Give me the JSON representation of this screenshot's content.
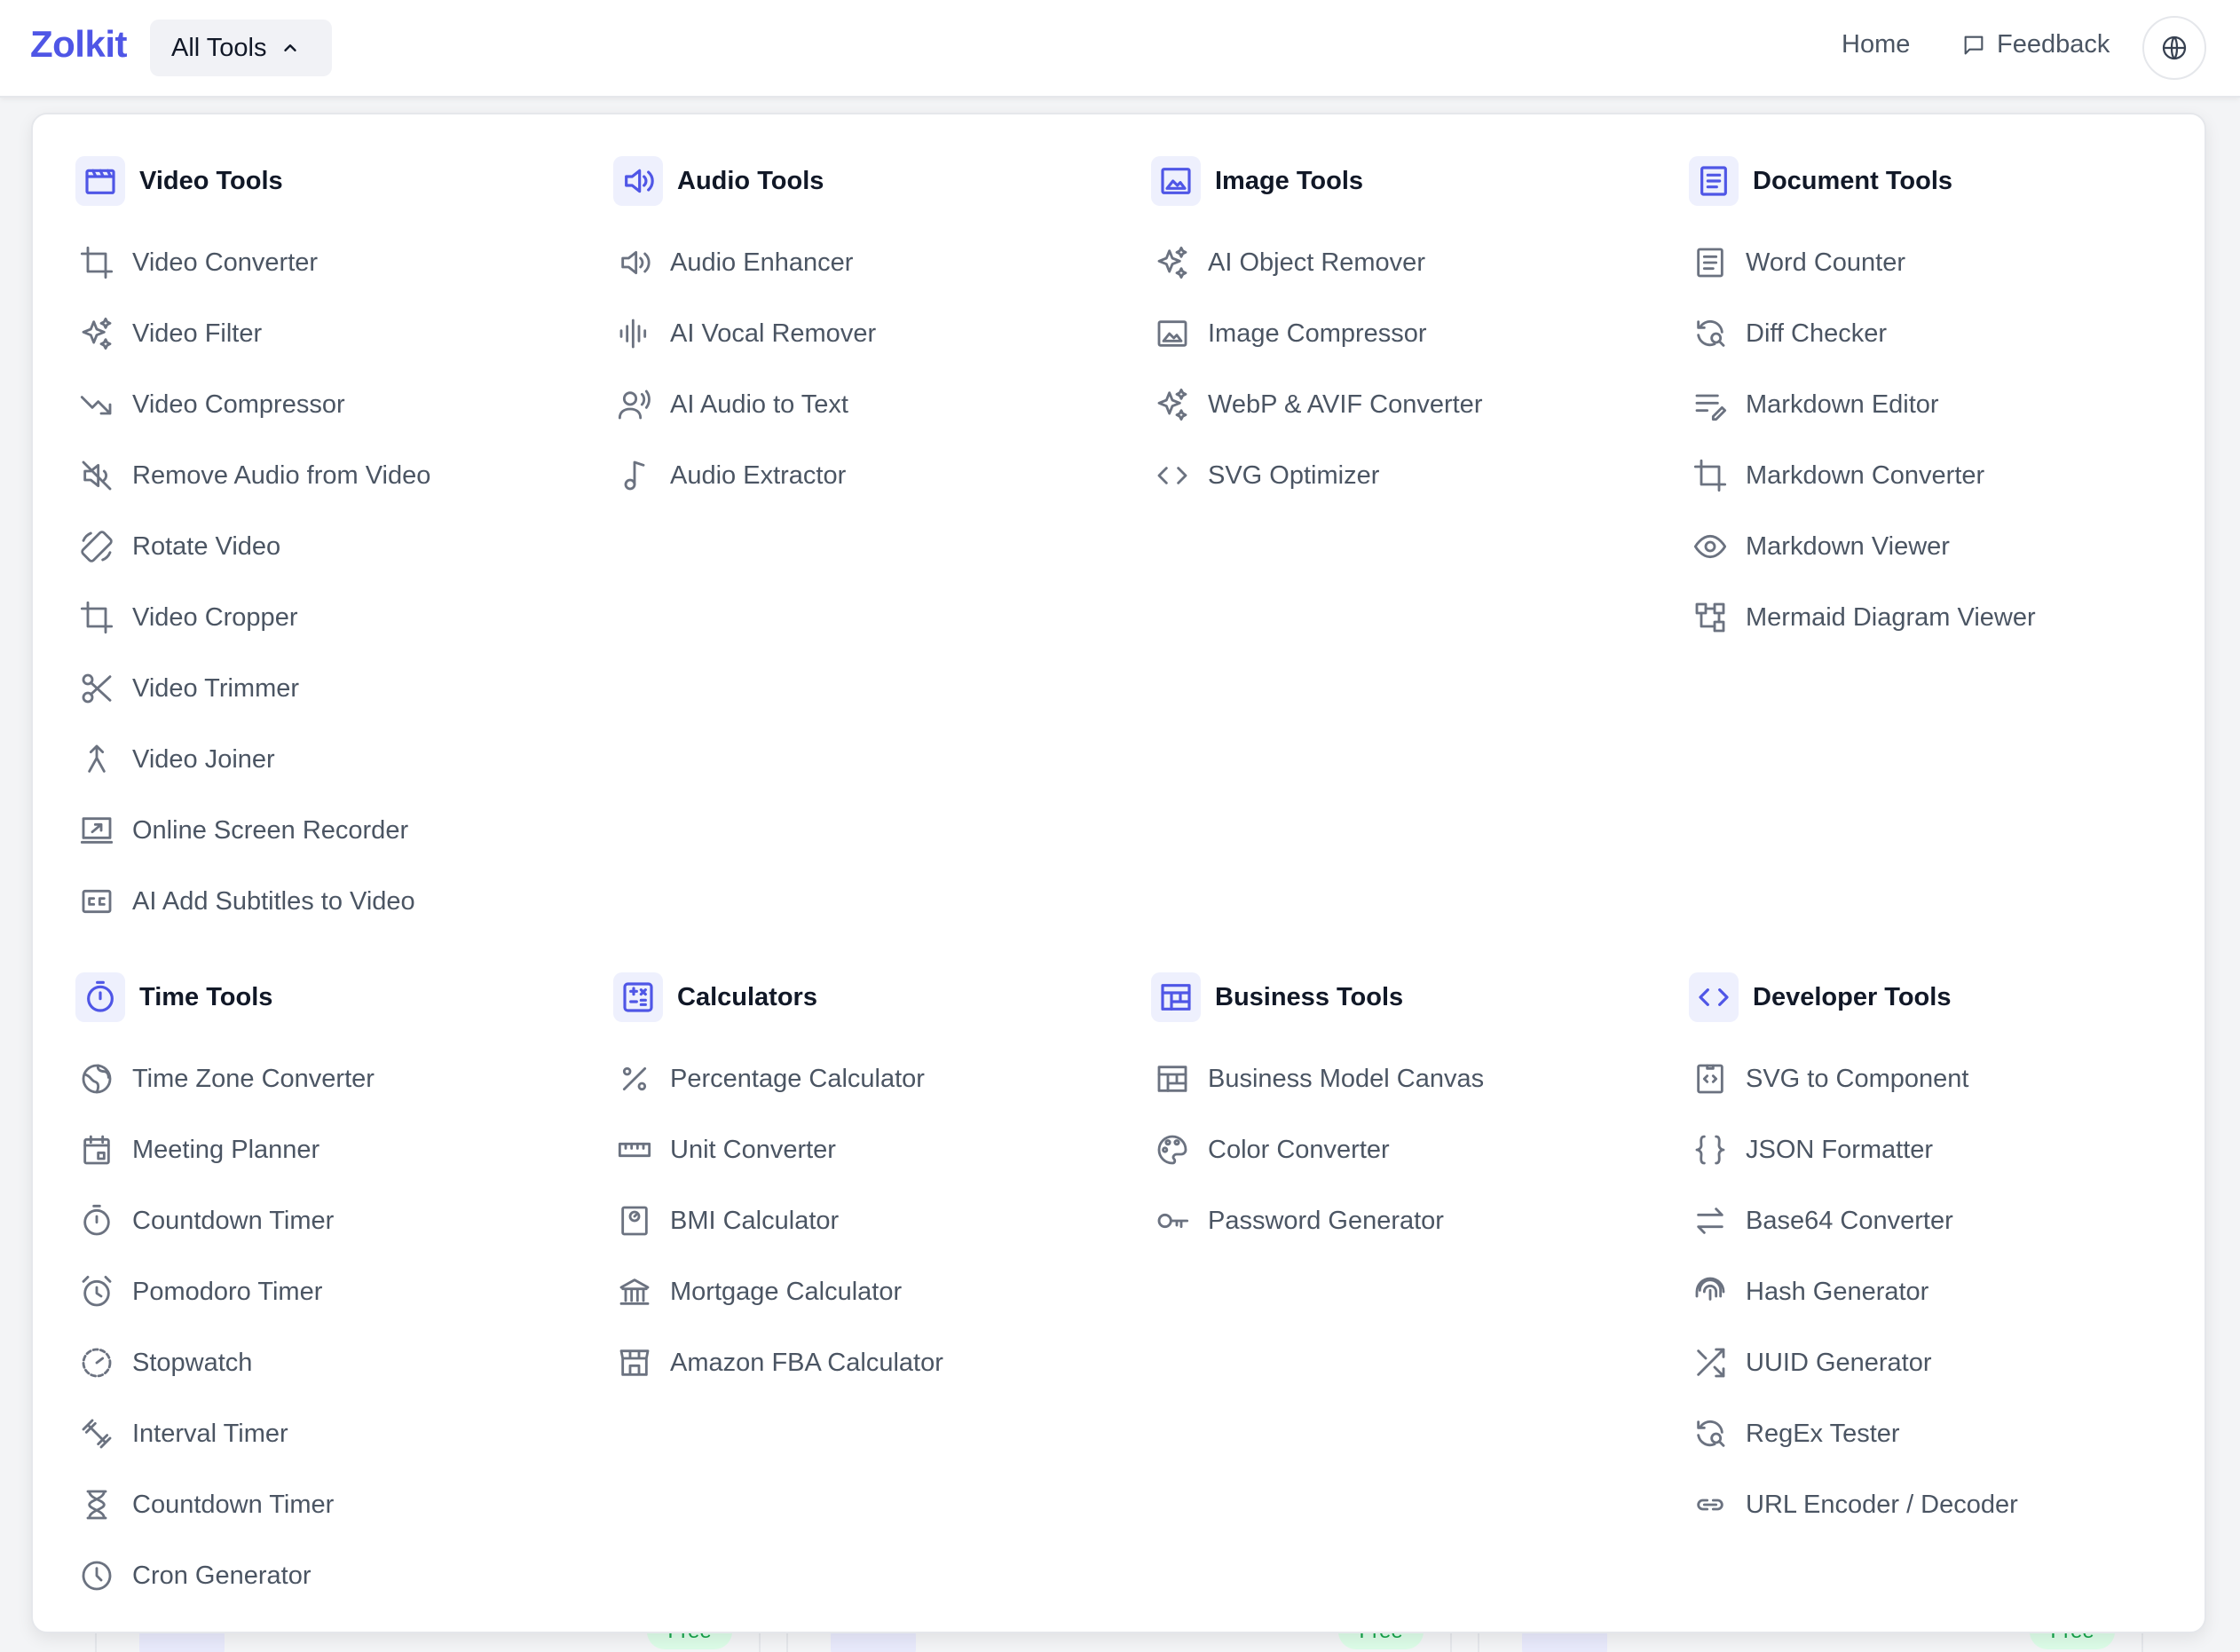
{
  "app": {
    "logo": "Zolkit"
  },
  "header": {
    "all_tools_label": "All Tools",
    "nav_home": "Home",
    "nav_feedback": "Feedback"
  },
  "colors": {
    "brand": "#4f56e6",
    "text_muted": "#4b5563",
    "badge_green": "#16a34a"
  },
  "sections": [
    {
      "title": "Video Tools",
      "icon": "clapperboard-icon",
      "items": [
        {
          "label": "Video Converter",
          "icon": "crop-icon"
        },
        {
          "label": "Video Filter",
          "icon": "sparkles-icon"
        },
        {
          "label": "Video Compressor",
          "icon": "trend-down-icon"
        },
        {
          "label": "Remove Audio from Video",
          "icon": "mute-icon"
        },
        {
          "label": "Rotate Video",
          "icon": "rotate-device-icon"
        },
        {
          "label": "Video Cropper",
          "icon": "crop-icon"
        },
        {
          "label": "Video Trimmer",
          "icon": "scissors-icon"
        },
        {
          "label": "Video Joiner",
          "icon": "merge-icon"
        },
        {
          "label": "Online Screen Recorder",
          "icon": "screen-share-icon"
        },
        {
          "label": "AI Add Subtitles to Video",
          "icon": "closed-caption-icon"
        }
      ]
    },
    {
      "title": "Audio Tools",
      "icon": "speaker-icon",
      "items": [
        {
          "label": "Audio Enhancer",
          "icon": "speaker-icon"
        },
        {
          "label": "AI Vocal Remover",
          "icon": "waveform-icon"
        },
        {
          "label": "AI Audio to Text",
          "icon": "voice-icon"
        },
        {
          "label": "Audio Extractor",
          "icon": "music-note-icon"
        }
      ]
    },
    {
      "title": "Image Tools",
      "icon": "image-icon",
      "items": [
        {
          "label": "AI Object Remover",
          "icon": "sparkles-icon"
        },
        {
          "label": "Image Compressor",
          "icon": "image-icon"
        },
        {
          "label": "WebP & AVIF Converter",
          "icon": "sparkles-icon"
        },
        {
          "label": "SVG Optimizer",
          "icon": "code-icon"
        }
      ]
    },
    {
      "title": "Document Tools",
      "icon": "document-icon",
      "items": [
        {
          "label": "Word Counter",
          "icon": "document-icon"
        },
        {
          "label": "Diff Checker",
          "icon": "refresh-search-icon"
        },
        {
          "label": "Markdown Editor",
          "icon": "edit-lines-icon"
        },
        {
          "label": "Markdown Converter",
          "icon": "crop-icon"
        },
        {
          "label": "Markdown Viewer",
          "icon": "eye-icon"
        },
        {
          "label": "Mermaid Diagram Viewer",
          "icon": "diagram-icon"
        }
      ]
    },
    {
      "title": "Time Tools",
      "icon": "stopwatch-icon",
      "items": [
        {
          "label": "Time Zone Converter",
          "icon": "globe-icon"
        },
        {
          "label": "Meeting Planner",
          "icon": "calendar-icon"
        },
        {
          "label": "Countdown Timer",
          "icon": "stopwatch-icon"
        },
        {
          "label": "Pomodoro Timer",
          "icon": "alarm-icon"
        },
        {
          "label": "Stopwatch",
          "icon": "timer-icon"
        },
        {
          "label": "Interval Timer",
          "icon": "dumbbell-icon"
        },
        {
          "label": "Countdown Timer",
          "icon": "hourglass-icon"
        },
        {
          "label": "Cron Generator",
          "icon": "clock-icon"
        }
      ]
    },
    {
      "title": "Calculators",
      "icon": "calculator-icon",
      "items": [
        {
          "label": "Percentage Calculator",
          "icon": "percent-icon"
        },
        {
          "label": "Unit Converter",
          "icon": "ruler-icon"
        },
        {
          "label": "BMI Calculator",
          "icon": "scale-icon"
        },
        {
          "label": "Mortgage Calculator",
          "icon": "bank-icon"
        },
        {
          "label": "Amazon FBA Calculator",
          "icon": "storefront-icon"
        }
      ]
    },
    {
      "title": "Business Tools",
      "icon": "layout-icon",
      "items": [
        {
          "label": "Business Model Canvas",
          "icon": "layout-icon"
        },
        {
          "label": "Color Converter",
          "icon": "palette-icon"
        },
        {
          "label": "Password Generator",
          "icon": "key-icon"
        }
      ]
    },
    {
      "title": "Developer Tools",
      "icon": "code-icon",
      "items": [
        {
          "label": "SVG to Component",
          "icon": "code-file-icon"
        },
        {
          "label": "JSON Formatter",
          "icon": "braces-icon"
        },
        {
          "label": "Base64 Converter",
          "icon": "swap-arrows-icon"
        },
        {
          "label": "Hash Generator",
          "icon": "fingerprint-icon"
        },
        {
          "label": "UUID Generator",
          "icon": "shuffle-icon"
        },
        {
          "label": "RegEx Tester",
          "icon": "refresh-search-icon"
        },
        {
          "label": "URL Encoder / Decoder",
          "icon": "link-icon"
        }
      ]
    }
  ],
  "background_cards": [
    {
      "badge": "Free"
    },
    {
      "badge": "Free"
    },
    {
      "badge": "Free"
    }
  ]
}
